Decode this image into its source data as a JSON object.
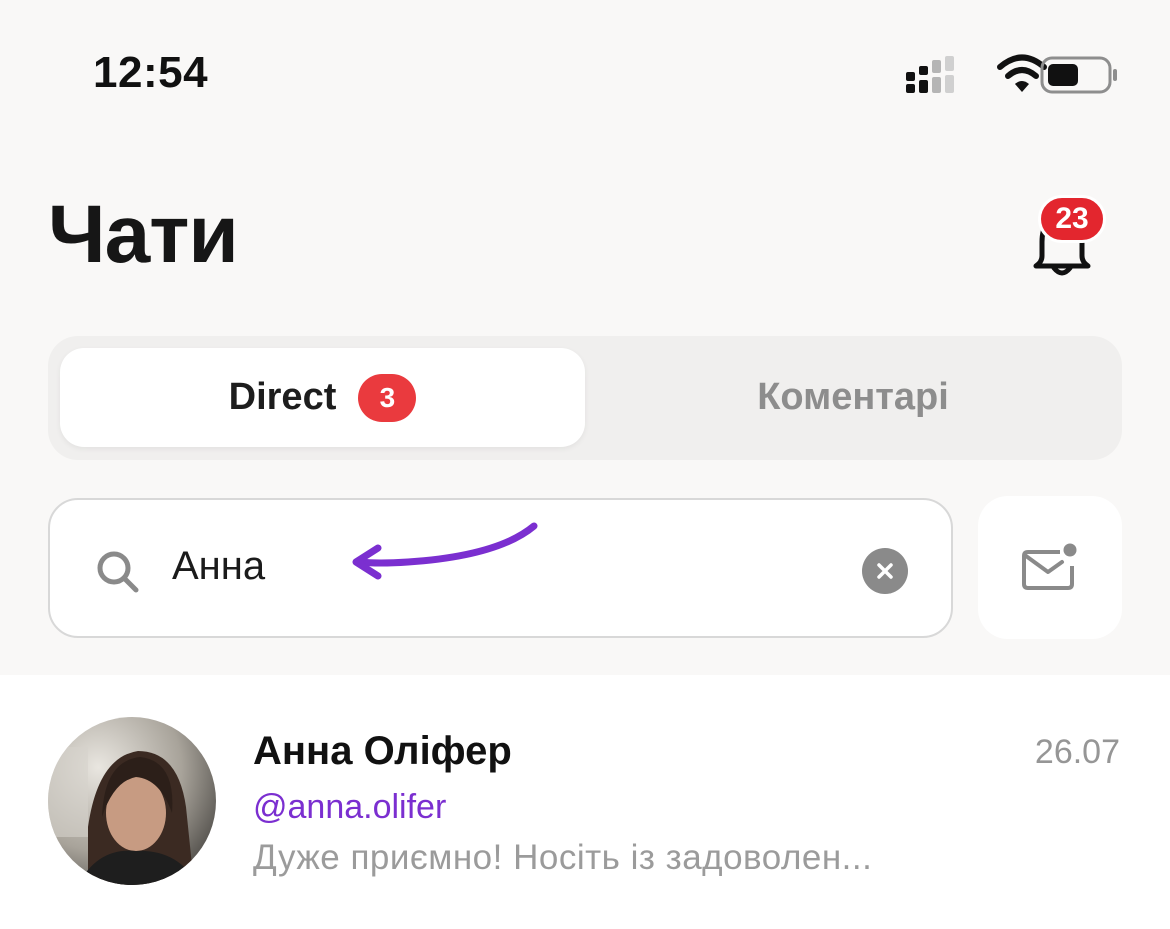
{
  "status_bar": {
    "time": "12:54"
  },
  "header": {
    "title": "Чати",
    "notifications_badge": "23"
  },
  "tabs": [
    {
      "label": "Direct",
      "badge": "3",
      "active": true
    },
    {
      "label": "Коментарі",
      "active": false
    }
  ],
  "search": {
    "value": "Анна"
  },
  "chats": [
    {
      "name": "Анна Оліфер",
      "handle": "@anna.olifer",
      "preview": "Дуже приємно! Носіть із задоволен...",
      "date": "26.07"
    }
  ],
  "icons": {
    "bell": "bell-icon",
    "search": "search-icon",
    "clear": "clear-icon",
    "compose": "new-message-icon",
    "signal": "signal-icon",
    "wifi": "wifi-icon",
    "battery": "battery-icon"
  },
  "colors": {
    "accent": "#7b2fd0",
    "badge_red": "#e3262e",
    "background": "#f9f8f7"
  }
}
